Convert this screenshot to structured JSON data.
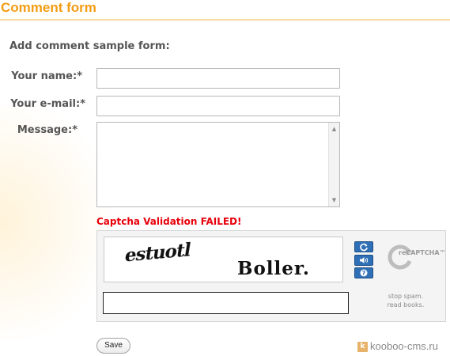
{
  "header": {
    "title": "Comment form"
  },
  "form": {
    "subtitle": "Add comment sample form:",
    "name_label": "Your name:*",
    "name_value": "",
    "email_label": "Your e-mail:*",
    "email_value": "",
    "message_label": "Message:*",
    "message_value": ""
  },
  "captcha": {
    "error_text": "Captcha Validation FAILED!",
    "challenge_words": [
      "estuotl",
      "Boller."
    ],
    "refresh_icon": "refresh-icon",
    "audio_icon": "speaker-icon",
    "help_icon": "help-icon",
    "logo_text": "reCAPTCHA™",
    "tagline_line1": "stop spam.",
    "tagline_line2": "read books.",
    "response_value": ""
  },
  "actions": {
    "save_label": "Save"
  },
  "footer": {
    "brand_text": "kooboo-cms.ru",
    "brand_icon_letter": "k"
  },
  "colors": {
    "title_orange": "#f39c12",
    "error_red": "#e8000b",
    "recaptcha_blue": "#2f6fb5"
  }
}
